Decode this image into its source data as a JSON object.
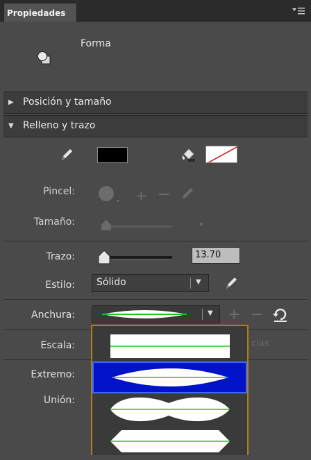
{
  "panel": {
    "title": "Propiedades"
  },
  "summary": {
    "object_type": "Forma"
  },
  "sections": {
    "position_size": "Posición y tamaño",
    "fill_stroke": "Relleno y trazo"
  },
  "labels": {
    "brush": "Pincel:",
    "size": "Tamaño:",
    "stroke": "Trazo:",
    "style": "Estilo:",
    "width": "Anchura:",
    "scale": "Escala:",
    "cap": "Extremo:",
    "join": "Unión:"
  },
  "stroke": {
    "value": "13.70",
    "style_value": "Sólido",
    "scale_hidden_tail": "cias"
  },
  "colors": {
    "panel_bg": "#4a4a4a",
    "stroke_color": "#000000",
    "fill_color": "none",
    "selection": "#0013c8",
    "dropdown_border": "#b07d1c",
    "profile_line": "#22c522"
  },
  "icons": {
    "menu": "panel-menu-icon",
    "shape": "shape-icon",
    "stroke_color": "pencil-icon",
    "fill_color": "paint-bucket-icon",
    "brush_add": "plus-icon",
    "brush_remove": "minus-icon",
    "brush_edit": "pencil-icon",
    "style_edit": "pencil-icon",
    "width_add": "plus-icon",
    "width_remove": "minus-icon",
    "width_reset": "reset-icon"
  },
  "width_profiles": [
    "uniform",
    "width-profile-1",
    "width-profile-2",
    "width-profile-3"
  ],
  "selected_width_profile": "width-profile-1"
}
